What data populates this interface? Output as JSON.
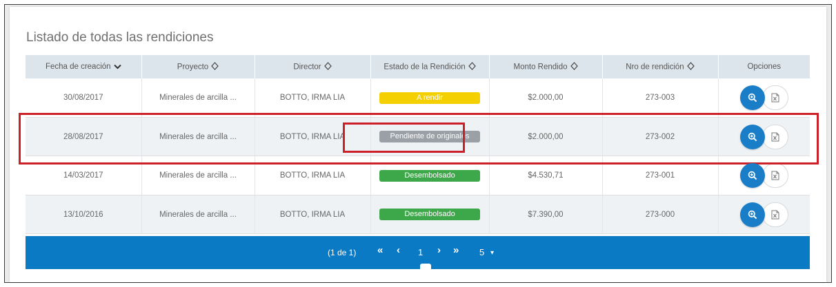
{
  "page": {
    "title": "Listado de todas las rendiciones"
  },
  "table": {
    "headers": [
      {
        "label": "Fecha de creación",
        "sort": "chevron-down-icon"
      },
      {
        "label": "Proyecto",
        "sort": "sort-icon"
      },
      {
        "label": "Director",
        "sort": "sort-icon"
      },
      {
        "label": "Estado de la Rendición",
        "sort": "sort-icon"
      },
      {
        "label": "Monto Rendido",
        "sort": "sort-icon"
      },
      {
        "label": "Nro de rendición",
        "sort": "sort-icon"
      },
      {
        "label": "Opciones",
        "sort": ""
      }
    ],
    "rows": [
      {
        "fecha": "30/08/2017",
        "proyecto": "Minerales de arcilla ...",
        "director": "BOTTO, IRMA LIA",
        "estado": "A rendir",
        "estado_color": "#f5d000",
        "monto": "$2.000,00",
        "nro": "273-003"
      },
      {
        "fecha": "28/08/2017",
        "proyecto": "Minerales de arcilla ...",
        "director": "BOTTO, IRMA LIA",
        "estado": "Pendiente de originales",
        "estado_color": "#9aa0a6",
        "monto": "$2.000,00",
        "nro": "273-002"
      },
      {
        "fecha": "14/03/2017",
        "proyecto": "Minerales de arcilla ...",
        "director": "BOTTO, IRMA LIA",
        "estado": "Desembolsado",
        "estado_color": "#3da849",
        "monto": "$4.530,71",
        "nro": "273-001"
      },
      {
        "fecha": "13/10/2016",
        "proyecto": "Minerales de arcilla ...",
        "director": "BOTTO, IRMA LIA",
        "estado": "Desembolsado",
        "estado_color": "#3da849",
        "monto": "$7.390,00",
        "nro": "273-000"
      }
    ]
  },
  "pagination": {
    "summary": "(1 de 1)",
    "first": "«",
    "prev": "‹",
    "current_page": "1",
    "next": "›",
    "last": "»",
    "page_size": "5",
    "page_size_caret": "▾"
  },
  "colors": {
    "accent_blue": "#0b7ac4",
    "button_blue": "#1a7dc8",
    "highlight_red": "#cc1f27"
  }
}
